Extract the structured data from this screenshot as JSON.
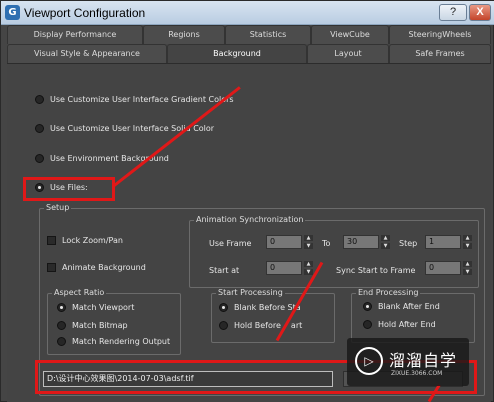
{
  "window": {
    "title": "Viewport Configuration",
    "help": "?",
    "close": "X"
  },
  "tabs_row1": [
    "Display Performance",
    "Regions",
    "Statistics",
    "ViewCube",
    "SteeringWheels"
  ],
  "tabs_row2": [
    "Visual Style & Appearance",
    "Background",
    "Layout",
    "Safe Frames"
  ],
  "active_tab": "Background",
  "source": {
    "opt_gradient": "Use Customize User Interface Gradient Colors",
    "opt_solid": "Use Customize User Interface Solid Color",
    "opt_env": "Use Environment Background",
    "opt_files": "Use Files:"
  },
  "setup": {
    "title": "Setup",
    "lock_zoom": "Lock Zoom/Pan",
    "animate_bg": "Animate Background",
    "aspect": {
      "title": "Aspect Ratio",
      "match_viewport": "Match Viewport",
      "match_bitmap": "Match Bitmap",
      "match_output": "Match Rendering Output"
    },
    "anim": {
      "title": "Animation Synchronization",
      "use_frame": "Use Frame",
      "use_frame_val": "0",
      "to": "To",
      "to_val": "30",
      "step": "Step",
      "step_val": "1",
      "start_at": "Start at",
      "start_at_val": "0",
      "sync_start": "Sync Start to Frame",
      "sync_start_val": "0"
    },
    "start_proc": {
      "title": "Start Processing",
      "blank_before": "Blank Before Sta",
      "hold_before": "Hold Before",
      "hold_before_tail": "art"
    },
    "end_proc": {
      "title": "End Processing",
      "blank_after": "Blank After End",
      "hold_after": "Hold After End"
    },
    "path": "D:\\设计中心效果图\\2014-07-03\\adsf.tif"
  },
  "watermark": {
    "logo": "▷",
    "name": "溜溜自学",
    "url": "ZIXUE.3066.COM"
  },
  "colors": {
    "annotation": "#e01818",
    "panel": "#444444",
    "titlebar": "#c9d9ea"
  }
}
